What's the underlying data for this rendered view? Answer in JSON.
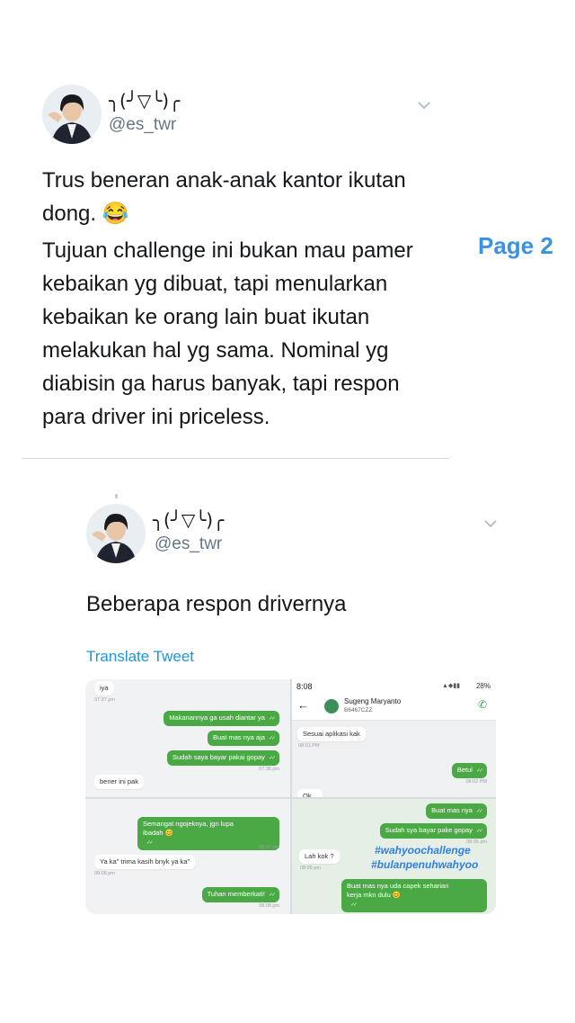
{
  "tweet1": {
    "name": "╮(╯▽╰)╭",
    "handle": "@es_twr",
    "paragraphs": [
      "Trus beneran anak-anak kantor ikutan dong. 😂",
      "Tujuan challenge ini bukan mau pamer kebaikan yg dibuat, tapi menularkan kebaikan ke orang lain buat ikutan melakukan hal yg sama. Nominal yg diabisin ga harus banyak, tapi respon para driver ini priceless."
    ]
  },
  "page_label": "Page 2",
  "tweet2": {
    "name": "╮(╯▽╰)╭",
    "handle": "@es_twr",
    "text": "Beberapa respon drivernya",
    "translate": "Translate Tweet"
  },
  "media": {
    "p1": {
      "in1": "iya",
      "ts_in1": "07:37 pm",
      "out1": "Makanannya ga usah diantar ya",
      "out2": "Buat mas nya aja",
      "out3": "Sudah saya bayar pakai gopay",
      "ts_out3": "07:38 pm",
      "in2": "bener ini pak",
      "ts_in2": "08:06 pm"
    },
    "p2": {
      "status_time": "8:08",
      "status_right": "28%",
      "contact_name": "Sugeng Maryanto",
      "contact_plate": "B6467CZZ",
      "in1": "Sesuai aplikasi kak",
      "ts_in1": "08:01 PM",
      "out1": "Betul",
      "ts_out1": "08:02 PM",
      "in2": "Ok..."
    },
    "p3": {
      "out1": "Semangat ngojeknya, jgn lupa",
      "out1b": "ibadah 😊",
      "ts_out1": "08:07 pm",
      "in1": "Ya ka\" trima kasih bnyk ya ka\"",
      "ts_in1": "08:08 pm",
      "out2": "Tuhan memberkati!",
      "ts_out2": "08:08 pm"
    },
    "p4": {
      "out1": "Buat mas nya",
      "out2": "Sudah sya bayar pake gopay",
      "ts_out2": "08:05 pm",
      "in1": "Lah kok ?",
      "ts_in1": "08:05 pm",
      "hashtag1": "#wahyoochallenge",
      "hashtag2": "#bulanpenuhwahyoo",
      "out3": "Buat mas nya uda capek seharian",
      "out3b": "kerja mkn dulu 😊"
    }
  },
  "colors": {
    "accent": "#1b95e0",
    "page_label": "#3b93e0",
    "bubble_out": "#4aa944"
  }
}
